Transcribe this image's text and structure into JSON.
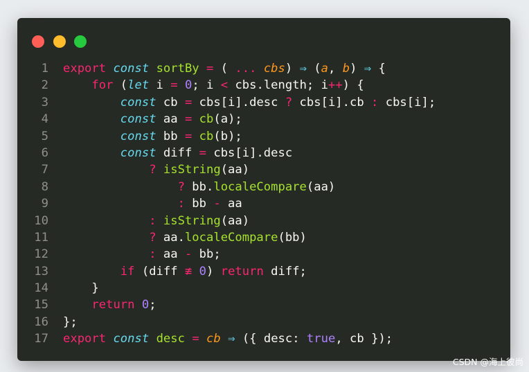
{
  "window": {
    "controls": [
      "close",
      "minimize",
      "maximize"
    ],
    "colors": {
      "red": "#ff5f56",
      "yellow": "#ffbd2e",
      "green": "#27c93f",
      "background": "#262a24"
    }
  },
  "code": {
    "line_numbers": [
      "1",
      "2",
      "3",
      "4",
      "5",
      "6",
      "7",
      "8",
      "9",
      "10",
      "11",
      "12",
      "13",
      "14",
      "15",
      "16",
      "17"
    ],
    "lines": [
      [
        [
          "k",
          "export"
        ],
        [
          "t",
          " "
        ],
        [
          "s",
          "const"
        ],
        [
          "t",
          " "
        ],
        [
          "f",
          "sortBy"
        ],
        [
          "t",
          " "
        ],
        [
          "o",
          "="
        ],
        [
          "t",
          " ( "
        ],
        [
          "o",
          "..."
        ],
        [
          "t",
          " "
        ],
        [
          "p",
          "cbs"
        ],
        [
          "t",
          ") "
        ],
        [
          "ar",
          "⇒"
        ],
        [
          "t",
          " ("
        ],
        [
          "p",
          "a"
        ],
        [
          "t",
          ", "
        ],
        [
          "p",
          "b"
        ],
        [
          "t",
          ") "
        ],
        [
          "ar",
          "⇒"
        ],
        [
          "t",
          " {"
        ]
      ],
      [
        [
          "t",
          "    "
        ],
        [
          "k",
          "for"
        ],
        [
          "t",
          " ("
        ],
        [
          "s",
          "let"
        ],
        [
          "t",
          " i "
        ],
        [
          "o",
          "="
        ],
        [
          "t",
          " "
        ],
        [
          "n",
          "0"
        ],
        [
          "t",
          "; i "
        ],
        [
          "o",
          "<"
        ],
        [
          "t",
          " cbs.length; i"
        ],
        [
          "o",
          "++"
        ],
        [
          "t",
          ") {"
        ]
      ],
      [
        [
          "t",
          "        "
        ],
        [
          "s",
          "const"
        ],
        [
          "t",
          " cb "
        ],
        [
          "o",
          "="
        ],
        [
          "t",
          " cbs[i].desc "
        ],
        [
          "o",
          "?"
        ],
        [
          "t",
          " cbs[i].cb "
        ],
        [
          "o",
          ":"
        ],
        [
          "t",
          " cbs[i];"
        ]
      ],
      [
        [
          "t",
          "        "
        ],
        [
          "s",
          "const"
        ],
        [
          "t",
          " aa "
        ],
        [
          "o",
          "="
        ],
        [
          "t",
          " "
        ],
        [
          "f",
          "cb"
        ],
        [
          "t",
          "(a);"
        ]
      ],
      [
        [
          "t",
          "        "
        ],
        [
          "s",
          "const"
        ],
        [
          "t",
          " bb "
        ],
        [
          "o",
          "="
        ],
        [
          "t",
          " "
        ],
        [
          "f",
          "cb"
        ],
        [
          "t",
          "(b);"
        ]
      ],
      [
        [
          "t",
          "        "
        ],
        [
          "s",
          "const"
        ],
        [
          "t",
          " diff "
        ],
        [
          "o",
          "="
        ],
        [
          "t",
          " cbs[i].desc"
        ]
      ],
      [
        [
          "t",
          "            "
        ],
        [
          "o",
          "?"
        ],
        [
          "t",
          " "
        ],
        [
          "f",
          "isString"
        ],
        [
          "t",
          "(aa)"
        ]
      ],
      [
        [
          "t",
          "                "
        ],
        [
          "o",
          "?"
        ],
        [
          "t",
          " bb."
        ],
        [
          "f",
          "localeCompare"
        ],
        [
          "t",
          "(aa)"
        ]
      ],
      [
        [
          "t",
          "                "
        ],
        [
          "o",
          ":"
        ],
        [
          "t",
          " bb "
        ],
        [
          "o",
          "-"
        ],
        [
          "t",
          " aa"
        ]
      ],
      [
        [
          "t",
          "            "
        ],
        [
          "o",
          ":"
        ],
        [
          "t",
          " "
        ],
        [
          "f",
          "isString"
        ],
        [
          "t",
          "(aa)"
        ]
      ],
      [
        [
          "t",
          "            "
        ],
        [
          "o",
          "?"
        ],
        [
          "t",
          " aa."
        ],
        [
          "f",
          "localeCompare"
        ],
        [
          "t",
          "(bb)"
        ]
      ],
      [
        [
          "t",
          "            "
        ],
        [
          "o",
          ":"
        ],
        [
          "t",
          " aa "
        ],
        [
          "o",
          "-"
        ],
        [
          "t",
          " bb;"
        ]
      ],
      [
        [
          "t",
          "        "
        ],
        [
          "k",
          "if"
        ],
        [
          "t",
          " (diff "
        ],
        [
          "o",
          "≢"
        ],
        [
          "t",
          " "
        ],
        [
          "n",
          "0"
        ],
        [
          "t",
          ") "
        ],
        [
          "k",
          "return"
        ],
        [
          "t",
          " diff;"
        ]
      ],
      [
        [
          "t",
          "    }"
        ]
      ],
      [
        [
          "t",
          "    "
        ],
        [
          "k",
          "return"
        ],
        [
          "t",
          " "
        ],
        [
          "n",
          "0"
        ],
        [
          "t",
          ";"
        ]
      ],
      [
        [
          "t",
          "};"
        ]
      ],
      [
        [
          "k",
          "export"
        ],
        [
          "t",
          " "
        ],
        [
          "s",
          "const"
        ],
        [
          "t",
          " "
        ],
        [
          "f",
          "desc"
        ],
        [
          "t",
          " "
        ],
        [
          "o",
          "="
        ],
        [
          "t",
          " "
        ],
        [
          "p",
          "cb"
        ],
        [
          "t",
          " "
        ],
        [
          "ar",
          "⇒"
        ],
        [
          "t",
          " ({ desc: "
        ],
        [
          "n",
          "true"
        ],
        [
          "t",
          ", cb });"
        ]
      ]
    ]
  },
  "watermark": "CSDN @海上彼尚"
}
